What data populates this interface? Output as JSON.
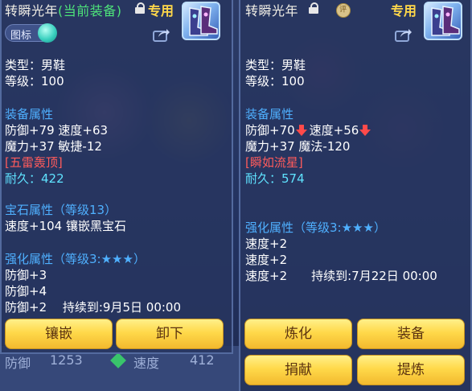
{
  "left_panel": {
    "title": "转瞬光年",
    "current_tag": "(当前装备)",
    "special_tag": "专用",
    "icon_button_label": "图标",
    "type_line": "类型：男鞋",
    "level_line": "等级：100",
    "equip_attr_header": "装备属性",
    "equip_lines": [
      "防御+79 速度+63",
      "魔力+37 敏捷-12"
    ],
    "effect": "[五雷轰顶]",
    "durability": "耐久：422",
    "gem_header": "宝石属性（等级13）",
    "gem_line": "速度+104 镶嵌黑宝石",
    "enhance_header": "强化属性（等级3:★★★）",
    "enhance_lines": [
      "防御+3",
      "防御+4",
      "防御+2　 持续到:9月5日 00:00"
    ],
    "buttons": [
      "镶嵌",
      "卸下"
    ]
  },
  "right_panel": {
    "title": "转瞬光年",
    "seal_label": "评",
    "special_tag": "专用",
    "type_line": "类型：男鞋",
    "level_line": "等级：100",
    "equip_attr_header": "装备属性",
    "equip_line1_a": "防御+70",
    "equip_line1_b": "速度+56",
    "equip_line2": "魔力+37 魔法-120",
    "effect": "[瞬如流星]",
    "durability": "耐久：574",
    "enhance_header": "强化属性（等级3:★★★）",
    "enhance_lines": [
      "速度+2",
      "速度+2",
      "速度+2　　持续到:7月22日 00:00"
    ],
    "buttons": [
      "炼化",
      "装备",
      "捐献",
      "提炼"
    ]
  },
  "background": {
    "stat_a": "防御",
    "stat_a_value": "1253",
    "stat_b": "速度",
    "stat_b_value": "412"
  },
  "colors": {
    "section_header": "#4fb0ff",
    "effect_red": "#ff5b5b",
    "durability_cyan": "#5fe3ff",
    "current_equipped_green": "#4ee37a",
    "special_yellow": "#ffd84a",
    "button_gold": "#ffd94a"
  },
  "icons": [
    "lock-icon",
    "share-icon",
    "boots-item-icon",
    "down-arrow-icon",
    "seal-icon"
  ]
}
